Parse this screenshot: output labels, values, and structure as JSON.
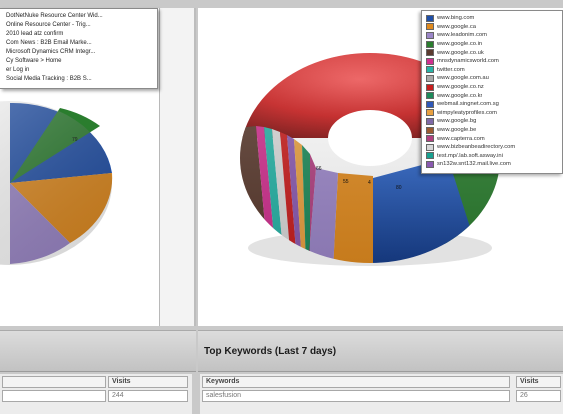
{
  "left_legend": {
    "lines": [
      "DotNetNuke Resource Center Wid...",
      "Online Resource Center - Trig...",
      "2010 lead atz confirm",
      "Com News : B2B Email Marke...",
      "Microsoft Dynamics CRM Integr...",
      "Cy Software > Home",
      "er Log in",
      "Social Media Tracking : B2B S..."
    ]
  },
  "right_legend": {
    "items": [
      {
        "label": "www.bing.com",
        "color": "#1f4fa8"
      },
      {
        "label": "www.google.ca",
        "color": "#e08a1e"
      },
      {
        "label": "www.leadonim.com",
        "color": "#9b86c8"
      },
      {
        "label": "www.google.co.in",
        "color": "#2a7d2e"
      },
      {
        "label": "www.google.co.uk",
        "color": "#5a3a2e"
      },
      {
        "label": "mnsdynamicsworld.com",
        "color": "#d0308f"
      },
      {
        "label": "twitter.com",
        "color": "#27b3a6"
      },
      {
        "label": "www.google.com.au",
        "color": "#a8a8a8"
      },
      {
        "label": "www.google.co.nz",
        "color": "#c81e1e"
      },
      {
        "label": "www.google.co.kr",
        "color": "#1d8a5a"
      },
      {
        "label": "webmail.singnet.com.sg",
        "color": "#2e58b8"
      },
      {
        "label": "wimpyleatyprofiles.com",
        "color": "#e8a040"
      },
      {
        "label": "www.google.bg",
        "color": "#7e6aa8"
      },
      {
        "label": "www.google.be",
        "color": "#9a5a30"
      },
      {
        "label": "www.capterra.com",
        "color": "#b04080"
      },
      {
        "label": "www.bizbeanbeadirectory.com",
        "color": "#d8d8d8"
      },
      {
        "label": "test.mp/.lab.soft.asway.ini",
        "color": "#18a090"
      },
      {
        "label": "sn132w.snt132.mail.live.com",
        "color": "#8a5ab0"
      }
    ]
  },
  "left_section": {
    "title": "",
    "columns": [
      "",
      "Visits"
    ],
    "rows": [
      [
        "",
        "244"
      ]
    ]
  },
  "right_section": {
    "title": "Top Keywords (Last 7 days)",
    "columns": [
      "Keywords",
      "Visits"
    ],
    "rows": [
      [
        "salesfusion",
        "26"
      ]
    ]
  },
  "chart_data": [
    {
      "type": "pie",
      "title": "",
      "slice_colors": [
        "#1f4fa8",
        "#e08a1e",
        "#9b86c8",
        "#2a7d2e"
      ],
      "data_labels": [
        "79"
      ]
    },
    {
      "type": "pie",
      "title": "",
      "slice_colors": [
        "#c81e1e",
        "#1f4fa8",
        "#e08a1e",
        "#9b86c8",
        "#2a7d2e",
        "#d0308f",
        "#27b3a6",
        "#a8a8a8",
        "#5a3a2e"
      ],
      "data_labels": [
        "66",
        "55",
        "4",
        "80"
      ]
    }
  ]
}
